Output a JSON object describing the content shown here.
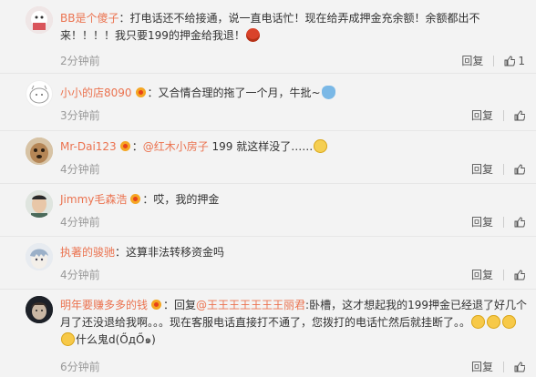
{
  "comments": [
    {
      "user": "BB是个傻子",
      "text_a": "：打电话还不给接通，说一直电话忙！现在给弄成押金充余额！余额都出不来！！！！我只要199的押金给我退！",
      "time": "2分钟前",
      "reply": "回复",
      "likes": "1"
    },
    {
      "user": "小小的店8090",
      "text_a": "：又合情合理的拖了一个月，牛批~",
      "time": "3分钟前",
      "reply": "回复"
    },
    {
      "user": "Mr-Dai123",
      "text_pre": "：",
      "mention": "@红木小房子",
      "text_a": " 199 就这样没了……",
      "time": "4分钟前",
      "reply": "回复"
    },
    {
      "user": "Jimmy毛森浩",
      "text_a": "：哎，我的押金",
      "time": "4分钟前",
      "reply": "回复"
    },
    {
      "user": "执著的骏驰",
      "text_a": "：这算非法转移资金吗",
      "time": "4分钟前",
      "reply": "回复"
    },
    {
      "user": "明年要赚多多的钱",
      "text_pre": "：回复",
      "mention": "@王王王王王王王丽君",
      "text_a": ":卧槽，这才想起我的199押金已经退了好几个月了还没退给我啊。。。现在客服电话直接打不通了，您拨打的电话忙然后就挂断了。。",
      "text_b": "什么鬼d(ŐдŐ๑)",
      "time": "6分钟前",
      "reply": "回复"
    }
  ]
}
